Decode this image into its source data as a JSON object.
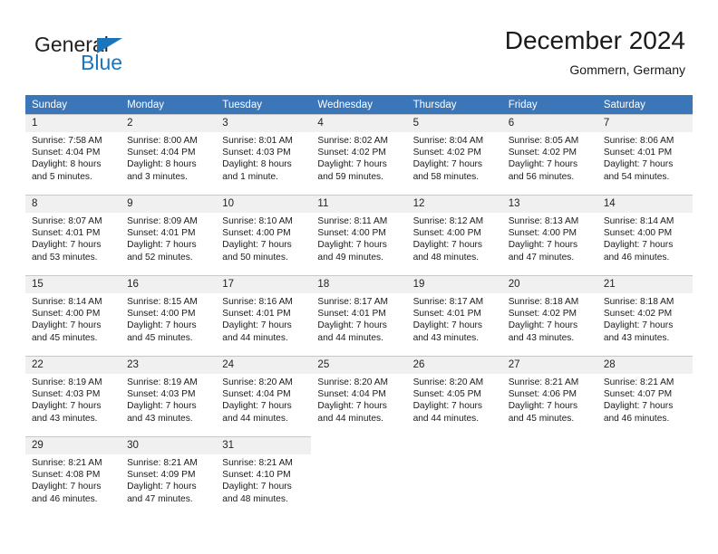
{
  "brand": {
    "name_part1": "General",
    "name_part2": "Blue",
    "flag_icon": "blue-triangle-flag",
    "color_dark": "#231f20",
    "color_blue": "#1b75bb"
  },
  "header": {
    "title": "December 2024",
    "subtitle": "Gommern, Germany"
  },
  "theme": {
    "header_bg": "#3b76b9",
    "header_text": "#ffffff",
    "daynum_bg": "#f0f0f0",
    "cell_bg": "#ffffff",
    "grid_line": "#c8c8c8"
  },
  "calendar": {
    "weekdays": [
      "Sunday",
      "Monday",
      "Tuesday",
      "Wednesday",
      "Thursday",
      "Friday",
      "Saturday"
    ],
    "weeks": [
      {
        "days": [
          {
            "num": "1",
            "sunrise": "Sunrise: 7:58 AM",
            "sunset": "Sunset: 4:04 PM",
            "daylight1": "Daylight: 8 hours",
            "daylight2": "and 5 minutes."
          },
          {
            "num": "2",
            "sunrise": "Sunrise: 8:00 AM",
            "sunset": "Sunset: 4:04 PM",
            "daylight1": "Daylight: 8 hours",
            "daylight2": "and 3 minutes."
          },
          {
            "num": "3",
            "sunrise": "Sunrise: 8:01 AM",
            "sunset": "Sunset: 4:03 PM",
            "daylight1": "Daylight: 8 hours",
            "daylight2": "and 1 minute."
          },
          {
            "num": "4",
            "sunrise": "Sunrise: 8:02 AM",
            "sunset": "Sunset: 4:02 PM",
            "daylight1": "Daylight: 7 hours",
            "daylight2": "and 59 minutes."
          },
          {
            "num": "5",
            "sunrise": "Sunrise: 8:04 AM",
            "sunset": "Sunset: 4:02 PM",
            "daylight1": "Daylight: 7 hours",
            "daylight2": "and 58 minutes."
          },
          {
            "num": "6",
            "sunrise": "Sunrise: 8:05 AM",
            "sunset": "Sunset: 4:02 PM",
            "daylight1": "Daylight: 7 hours",
            "daylight2": "and 56 minutes."
          },
          {
            "num": "7",
            "sunrise": "Sunrise: 8:06 AM",
            "sunset": "Sunset: 4:01 PM",
            "daylight1": "Daylight: 7 hours",
            "daylight2": "and 54 minutes."
          }
        ]
      },
      {
        "days": [
          {
            "num": "8",
            "sunrise": "Sunrise: 8:07 AM",
            "sunset": "Sunset: 4:01 PM",
            "daylight1": "Daylight: 7 hours",
            "daylight2": "and 53 minutes."
          },
          {
            "num": "9",
            "sunrise": "Sunrise: 8:09 AM",
            "sunset": "Sunset: 4:01 PM",
            "daylight1": "Daylight: 7 hours",
            "daylight2": "and 52 minutes."
          },
          {
            "num": "10",
            "sunrise": "Sunrise: 8:10 AM",
            "sunset": "Sunset: 4:00 PM",
            "daylight1": "Daylight: 7 hours",
            "daylight2": "and 50 minutes."
          },
          {
            "num": "11",
            "sunrise": "Sunrise: 8:11 AM",
            "sunset": "Sunset: 4:00 PM",
            "daylight1": "Daylight: 7 hours",
            "daylight2": "and 49 minutes."
          },
          {
            "num": "12",
            "sunrise": "Sunrise: 8:12 AM",
            "sunset": "Sunset: 4:00 PM",
            "daylight1": "Daylight: 7 hours",
            "daylight2": "and 48 minutes."
          },
          {
            "num": "13",
            "sunrise": "Sunrise: 8:13 AM",
            "sunset": "Sunset: 4:00 PM",
            "daylight1": "Daylight: 7 hours",
            "daylight2": "and 47 minutes."
          },
          {
            "num": "14",
            "sunrise": "Sunrise: 8:14 AM",
            "sunset": "Sunset: 4:00 PM",
            "daylight1": "Daylight: 7 hours",
            "daylight2": "and 46 minutes."
          }
        ]
      },
      {
        "days": [
          {
            "num": "15",
            "sunrise": "Sunrise: 8:14 AM",
            "sunset": "Sunset: 4:00 PM",
            "daylight1": "Daylight: 7 hours",
            "daylight2": "and 45 minutes."
          },
          {
            "num": "16",
            "sunrise": "Sunrise: 8:15 AM",
            "sunset": "Sunset: 4:00 PM",
            "daylight1": "Daylight: 7 hours",
            "daylight2": "and 45 minutes."
          },
          {
            "num": "17",
            "sunrise": "Sunrise: 8:16 AM",
            "sunset": "Sunset: 4:01 PM",
            "daylight1": "Daylight: 7 hours",
            "daylight2": "and 44 minutes."
          },
          {
            "num": "18",
            "sunrise": "Sunrise: 8:17 AM",
            "sunset": "Sunset: 4:01 PM",
            "daylight1": "Daylight: 7 hours",
            "daylight2": "and 44 minutes."
          },
          {
            "num": "19",
            "sunrise": "Sunrise: 8:17 AM",
            "sunset": "Sunset: 4:01 PM",
            "daylight1": "Daylight: 7 hours",
            "daylight2": "and 43 minutes."
          },
          {
            "num": "20",
            "sunrise": "Sunrise: 8:18 AM",
            "sunset": "Sunset: 4:02 PM",
            "daylight1": "Daylight: 7 hours",
            "daylight2": "and 43 minutes."
          },
          {
            "num": "21",
            "sunrise": "Sunrise: 8:18 AM",
            "sunset": "Sunset: 4:02 PM",
            "daylight1": "Daylight: 7 hours",
            "daylight2": "and 43 minutes."
          }
        ]
      },
      {
        "days": [
          {
            "num": "22",
            "sunrise": "Sunrise: 8:19 AM",
            "sunset": "Sunset: 4:03 PM",
            "daylight1": "Daylight: 7 hours",
            "daylight2": "and 43 minutes."
          },
          {
            "num": "23",
            "sunrise": "Sunrise: 8:19 AM",
            "sunset": "Sunset: 4:03 PM",
            "daylight1": "Daylight: 7 hours",
            "daylight2": "and 43 minutes."
          },
          {
            "num": "24",
            "sunrise": "Sunrise: 8:20 AM",
            "sunset": "Sunset: 4:04 PM",
            "daylight1": "Daylight: 7 hours",
            "daylight2": "and 44 minutes."
          },
          {
            "num": "25",
            "sunrise": "Sunrise: 8:20 AM",
            "sunset": "Sunset: 4:04 PM",
            "daylight1": "Daylight: 7 hours",
            "daylight2": "and 44 minutes."
          },
          {
            "num": "26",
            "sunrise": "Sunrise: 8:20 AM",
            "sunset": "Sunset: 4:05 PM",
            "daylight1": "Daylight: 7 hours",
            "daylight2": "and 44 minutes."
          },
          {
            "num": "27",
            "sunrise": "Sunrise: 8:21 AM",
            "sunset": "Sunset: 4:06 PM",
            "daylight1": "Daylight: 7 hours",
            "daylight2": "and 45 minutes."
          },
          {
            "num": "28",
            "sunrise": "Sunrise: 8:21 AM",
            "sunset": "Sunset: 4:07 PM",
            "daylight1": "Daylight: 7 hours",
            "daylight2": "and 46 minutes."
          }
        ]
      },
      {
        "days": [
          {
            "num": "29",
            "sunrise": "Sunrise: 8:21 AM",
            "sunset": "Sunset: 4:08 PM",
            "daylight1": "Daylight: 7 hours",
            "daylight2": "and 46 minutes."
          },
          {
            "num": "30",
            "sunrise": "Sunrise: 8:21 AM",
            "sunset": "Sunset: 4:09 PM",
            "daylight1": "Daylight: 7 hours",
            "daylight2": "and 47 minutes."
          },
          {
            "num": "31",
            "sunrise": "Sunrise: 8:21 AM",
            "sunset": "Sunset: 4:10 PM",
            "daylight1": "Daylight: 7 hours",
            "daylight2": "and 48 minutes."
          },
          {
            "num": "",
            "sunrise": "",
            "sunset": "",
            "daylight1": "",
            "daylight2": ""
          },
          {
            "num": "",
            "sunrise": "",
            "sunset": "",
            "daylight1": "",
            "daylight2": ""
          },
          {
            "num": "",
            "sunrise": "",
            "sunset": "",
            "daylight1": "",
            "daylight2": ""
          },
          {
            "num": "",
            "sunrise": "",
            "sunset": "",
            "daylight1": "",
            "daylight2": ""
          }
        ]
      }
    ]
  }
}
